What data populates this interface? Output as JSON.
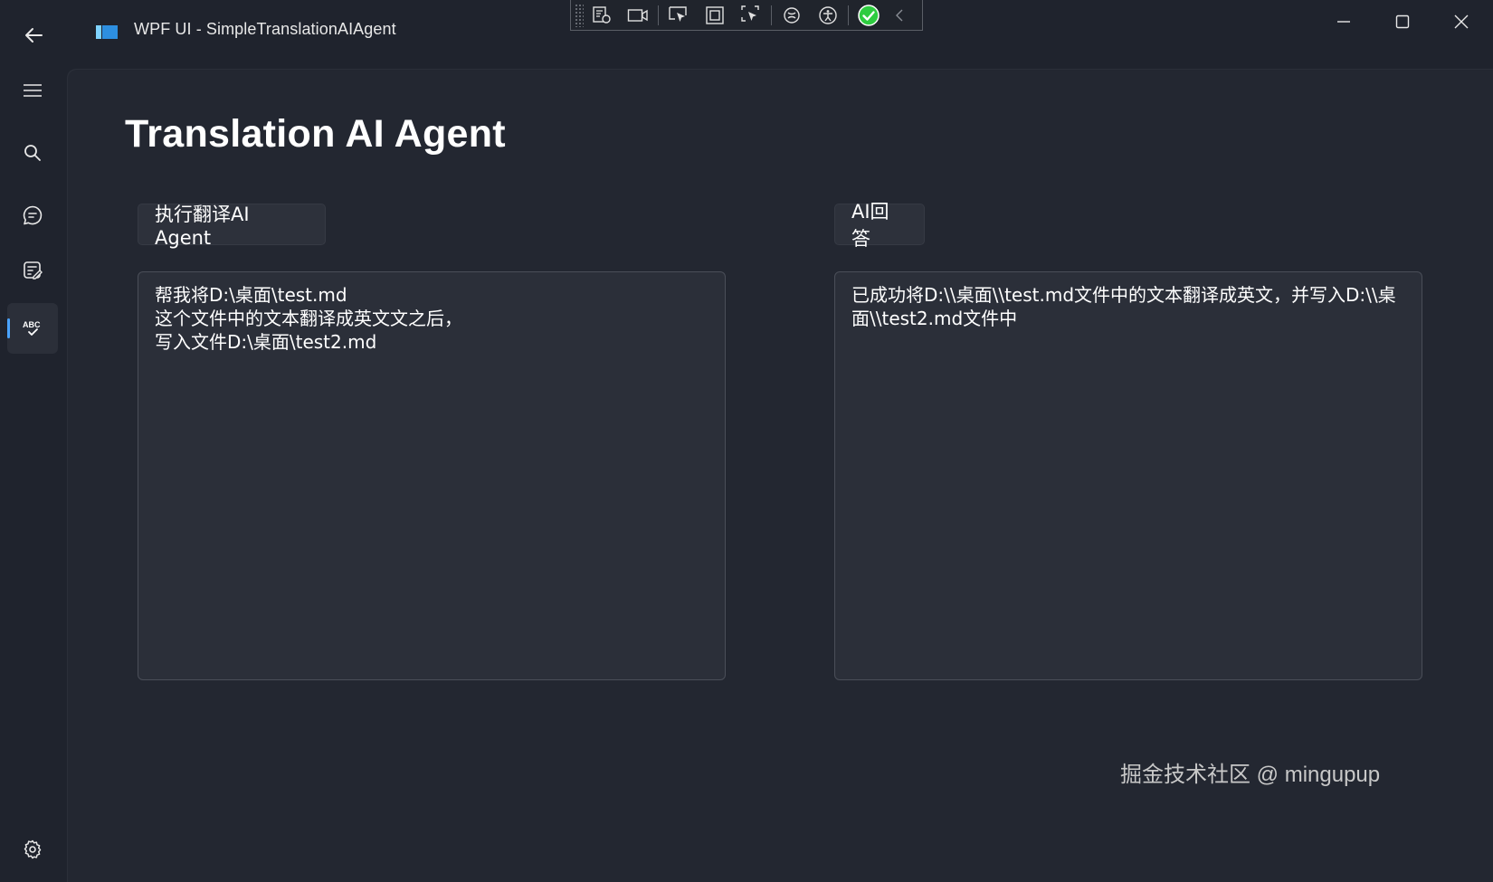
{
  "window": {
    "title": "WPF UI - SimpleTranslationAIAgent"
  },
  "colors": {
    "accent": "#4aa3ff",
    "background": "#1f232d",
    "content_bg": "#232731",
    "textbox_bg": "#2b2f39",
    "success": "#2ecc40"
  },
  "debug_toolbar": {
    "icons": [
      "live-visual-tree-icon",
      "record-icon",
      "select-element-icon",
      "display-layout-adorners-icon",
      "track-focus-icon",
      "hot-reload-icon",
      "accessibility-icon",
      "binding-status-ok-icon",
      "collapse-chevron-icon"
    ]
  },
  "sidebar": {
    "items": [
      {
        "icon": "hamburger-menu-icon"
      },
      {
        "icon": "search-icon"
      },
      {
        "icon": "chat-icon"
      },
      {
        "icon": "task-edit-icon"
      },
      {
        "icon": "spell-check-icon",
        "active": true
      }
    ],
    "footer_icon": "settings-gear-icon"
  },
  "main": {
    "page_title": "Translation AI Agent",
    "run_button_label": "执行翻译AI Agent",
    "answer_button_label": "AI回答",
    "input_text": "帮我将D:\\桌面\\test.md\n这个文件中的文本翻译成英文文之后，\n写入文件D:\\桌面\\test2.md",
    "output_text": "已成功将D:\\\\桌面\\\\test.md文件中的文本翻译成英文，并写入D:\\\\桌面\\\\test2.md文件中"
  },
  "watermark": "掘金技术社区 @ mingupup"
}
